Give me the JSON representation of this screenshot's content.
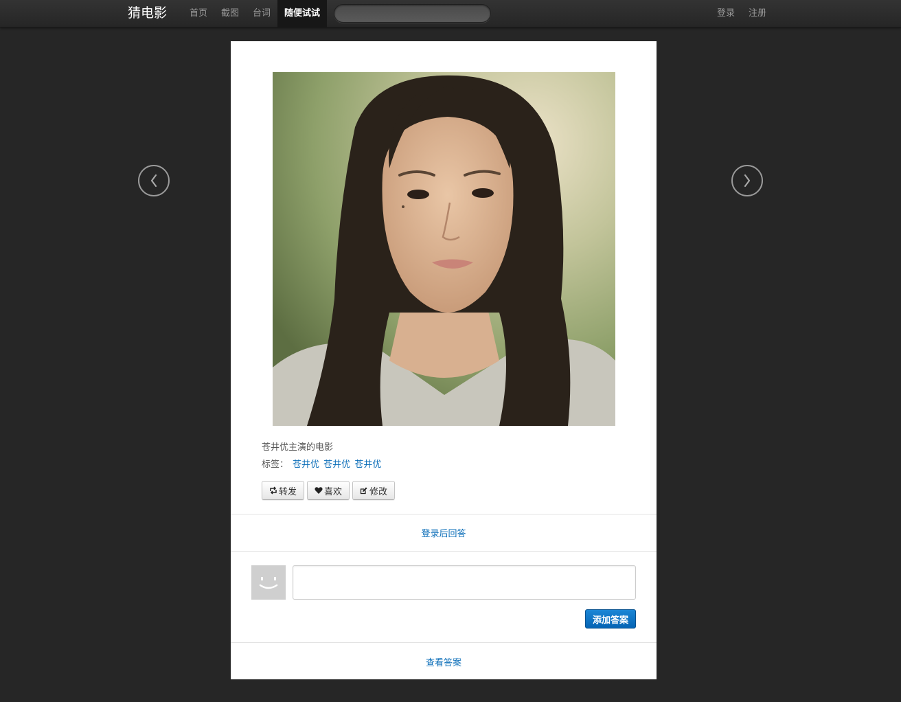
{
  "navbar": {
    "brand": "猜电影",
    "items": [
      {
        "label": "首页"
      },
      {
        "label": "截图"
      },
      {
        "label": "台词"
      },
      {
        "label": "随便试试"
      }
    ],
    "search_value": "",
    "auth": {
      "login": "登录",
      "register": "注册"
    }
  },
  "nav_arrows": {
    "prev_icon": "chevron-left-icon",
    "next_icon": "chevron-right-icon"
  },
  "post": {
    "caption": "苍井优主演的电影",
    "tags_label": "标签：",
    "tags": [
      "苍井优",
      "苍井优",
      "苍井优"
    ],
    "actions": [
      {
        "label": "转发",
        "icon": "retweet-icon"
      },
      {
        "label": "喜欢",
        "icon": "heart-icon"
      },
      {
        "label": "修改",
        "icon": "edit-icon"
      }
    ]
  },
  "answer": {
    "login_prompt": "登录后回答",
    "input_value": "",
    "submit_label": "添加答案",
    "view_answers": "查看答案"
  },
  "colors": {
    "page_background": "#262626",
    "link": "#0a6db8",
    "primary_button": "#0a6db8"
  }
}
